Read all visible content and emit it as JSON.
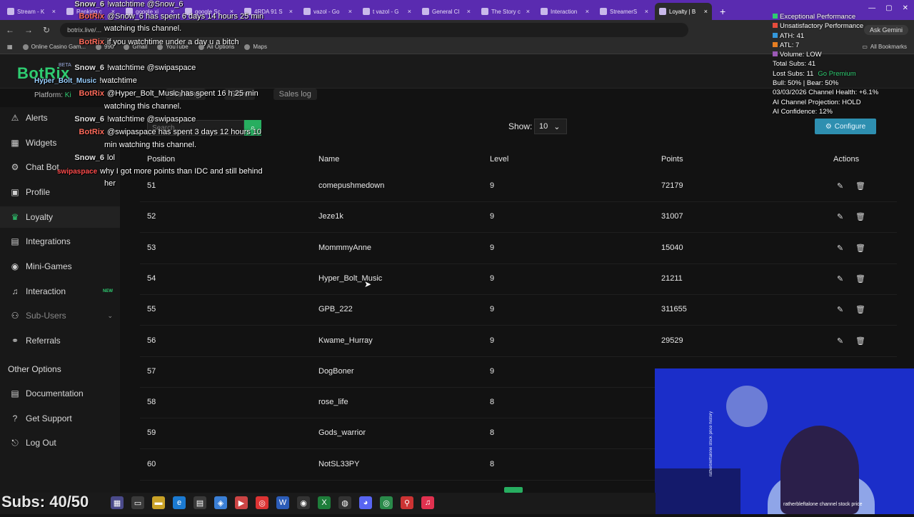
{
  "browser": {
    "tabs": [
      {
        "label": "Stream - K"
      },
      {
        "label": "Ranking c"
      },
      {
        "label": "google xi"
      },
      {
        "label": "google Sc"
      },
      {
        "label": "4RDA 91 S"
      },
      {
        "label": "vazol - Go"
      },
      {
        "label": "t vazol - G"
      },
      {
        "label": "General Cl"
      },
      {
        "label": "The Story c"
      },
      {
        "label": "Interaction"
      },
      {
        "label": "StreamerS"
      },
      {
        "label": "Loyalty | B"
      }
    ],
    "new_tab": "+",
    "url": "botrix.live/...",
    "ask_button": "Ask Gemini",
    "bookmarks": [
      "Online Casino Gam...",
      "990",
      "Gmail",
      "YouTube",
      "All Options",
      "Maps"
    ],
    "all_bookmarks": "All Bookmarks"
  },
  "app": {
    "logo": "BotRix",
    "logo_badge": "BETA",
    "platform_label": "Platform:",
    "platform_value": "Ki"
  },
  "sidebar": {
    "items": [
      {
        "label": "Alerts",
        "icon": "warning-icon"
      },
      {
        "label": "Widgets",
        "icon": "grid-icon"
      },
      {
        "label": "Chat Bot",
        "icon": "robot-icon"
      },
      {
        "label": "Profile",
        "icon": "profile-icon"
      },
      {
        "label": "Loyalty",
        "icon": "trophy-icon"
      },
      {
        "label": "Integrations",
        "icon": "integrations-icon"
      },
      {
        "label": "Mini-Games",
        "icon": "gamepad-icon"
      },
      {
        "label": "Interaction",
        "icon": "music-icon",
        "badge": "NEW"
      },
      {
        "label": "Sub-Users",
        "icon": "users-icon"
      },
      {
        "label": "Referrals",
        "icon": "referrals-icon"
      }
    ],
    "other_heading": "Other Options",
    "other_items": [
      {
        "label": "Documentation",
        "icon": "doc-icon"
      },
      {
        "label": "Get Support",
        "icon": "help-icon"
      },
      {
        "label": "Log Out",
        "icon": "logout-icon"
      }
    ]
  },
  "main": {
    "tabs": [
      "Ranking",
      "Store",
      "Sales log"
    ],
    "search_placeholder": "Search...",
    "show_label": "Show:",
    "show_value": "10",
    "configure_label": "Configure",
    "columns": [
      "Position",
      "Name",
      "Level",
      "Points",
      "Actions"
    ],
    "rows": [
      {
        "position": "51",
        "name": "comepushmedown",
        "level": "9",
        "points": "72179"
      },
      {
        "position": "52",
        "name": "Jeze1k",
        "level": "9",
        "points": "31007"
      },
      {
        "position": "53",
        "name": "MommmyAnne",
        "level": "9",
        "points": "15040"
      },
      {
        "position": "54",
        "name": "Hyper_Bolt_Music",
        "level": "9",
        "points": "21211"
      },
      {
        "position": "55",
        "name": "GPB_222",
        "level": "9",
        "points": "311655"
      },
      {
        "position": "56",
        "name": "Kwame_Hurray",
        "level": "9",
        "points": "29529"
      },
      {
        "position": "57",
        "name": "DogBoner",
        "level": "9",
        "points": ""
      },
      {
        "position": "58",
        "name": "rose_life",
        "level": "8",
        "points": ""
      },
      {
        "position": "59",
        "name": "Gods_warrior",
        "level": "8",
        "points": ""
      },
      {
        "position": "60",
        "name": "NotSL33PY",
        "level": "8",
        "points": ""
      }
    ]
  },
  "chat": [
    {
      "user": "Snow_6",
      "text": "!watchtime @Snow_6"
    },
    {
      "user": "BotRix",
      "text": "@Snow_6 has spent 6 days 14 hours 25 min"
    },
    {
      "user": "",
      "text": "watching this channel."
    },
    {
      "user": "BotRix",
      "text": "if you watchtime under a day u a bitch"
    },
    {
      "user": "Snow_6",
      "text": "!watchtime @swipaspace"
    },
    {
      "user": "Hyper_Bolt_Music",
      "text": "!watchtime"
    },
    {
      "user": "BotRix",
      "text": "@Hyper_Bolt_Music has spent 16 h 25 min"
    },
    {
      "user": "",
      "text": "watching this channel."
    },
    {
      "user": "Snow_6",
      "text": "!watchtime @swipaspace"
    },
    {
      "user": "BotRix",
      "text": "@swipaspace has spent 3 days 12 hours 10"
    },
    {
      "user": "",
      "text": "min watching this channel."
    },
    {
      "user": "Snow_6",
      "text": "lol"
    },
    {
      "user": "swipaspace",
      "text": "why I got more points than IDC and still behind"
    },
    {
      "user": "",
      "text": "her"
    }
  ],
  "overlay": {
    "lines": [
      {
        "text": "Exceptional Performance",
        "color": "#2ecc71"
      },
      {
        "text": "Unsatisfactory Performance",
        "color": "#e74c3c"
      },
      {
        "text": "ATH: 41",
        "color": "#3498db"
      },
      {
        "text": "ATL: 7",
        "color": "#e67e22"
      },
      {
        "text": "Volume: LOW",
        "color": "#9b59b6"
      },
      {
        "text": "Total Subs: 41",
        "color": ""
      },
      {
        "text": "Lost Subs: 11",
        "color": ""
      },
      {
        "text": "Bull: 50% | Bear: 50%",
        "color": ""
      },
      {
        "text": "03/03/2026 Channel Health: +6.1%",
        "color": ""
      },
      {
        "text": "AI Channel Projection: HOLD",
        "color": ""
      },
      {
        "text": "AI Confidence: 12%",
        "color": ""
      }
    ],
    "go_premium": "Go Premium"
  },
  "webcam": {
    "caption": "ratherbleftalone channel stock price",
    "side_caption": "ratherbleftalone stock price history"
  },
  "subs_counter": "Subs: 40/50"
}
